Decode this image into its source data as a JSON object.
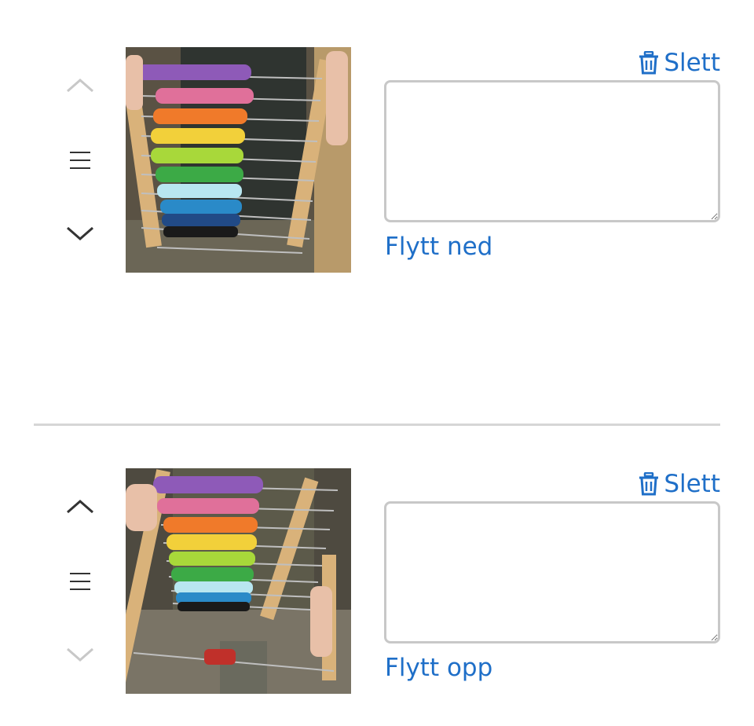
{
  "items": [
    {
      "delete_label": "Slett",
      "caption_value": "",
      "move_label": "Flytt ned",
      "move_up_enabled": false,
      "move_down_enabled": true,
      "image_alt": "abacus-photo"
    },
    {
      "delete_label": "Slett",
      "caption_value": "",
      "move_label": "Flytt opp",
      "move_up_enabled": true,
      "move_down_enabled": false,
      "image_alt": "abacus-photo"
    }
  ],
  "colors": {
    "accent": "#1f6fc8",
    "icon_enabled": "#333333",
    "icon_disabled": "#c8c8c8",
    "border": "#c8c8c8",
    "divider": "#d6d6d6"
  },
  "icons": {
    "up": "chevron-up-icon",
    "handle": "drag-handle-icon",
    "down": "chevron-down-icon",
    "delete": "trash-icon"
  }
}
